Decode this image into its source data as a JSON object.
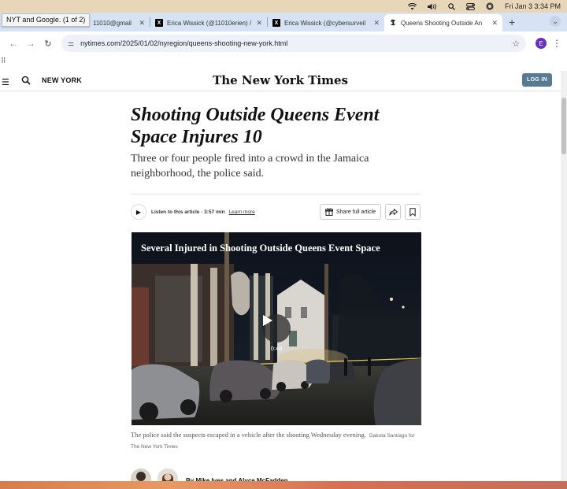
{
  "menubar": {
    "datetime": "Fri Jan 3  3:34 PM"
  },
  "tooltip": "NYT and Google.  (1 of 2)",
  "tabs": [
    {
      "title": "11010@gmail",
      "active": false
    },
    {
      "title": "Erica Wissick (@11010erien) /",
      "active": false
    },
    {
      "title": "Erica Wissick (@cybersurveil",
      "active": false
    },
    {
      "title": "Queens Shooting Outside An",
      "active": true
    }
  ],
  "tab_icons": {
    "x": "X",
    "nyt": "𝕿"
  },
  "toolbar": {
    "url": "nytimes.com/2025/01/02/nyregion/queens-shooting-new-york.html",
    "profile_initial": "E"
  },
  "nyt": {
    "section": "NEW YORK",
    "masthead": "The New York Times",
    "login": "LOG IN"
  },
  "article": {
    "headline": "Shooting Outside Queens Event Space Injures 10",
    "dek": "Three or four people fired into a crowd in the Jamaica neighborhood, the police said.",
    "listen": "Listen to this article · 3:57 min",
    "learn_more": "Learn more",
    "share": "Share full article",
    "video_title": "Several Injured in Shooting Outside Queens Event Space",
    "video_duration": "0:48",
    "caption": "The police said the suspects escaped in a vehicle after the shooting Wednesday evening.",
    "credit": "Dakota Santiago for The New York Times",
    "byline": "By Mike Ives and Alyce McFadden"
  },
  "colors": {
    "login_bg": "#567b95",
    "tab_strip": "#d7e3f4",
    "menubar": "#e8d6b8"
  }
}
